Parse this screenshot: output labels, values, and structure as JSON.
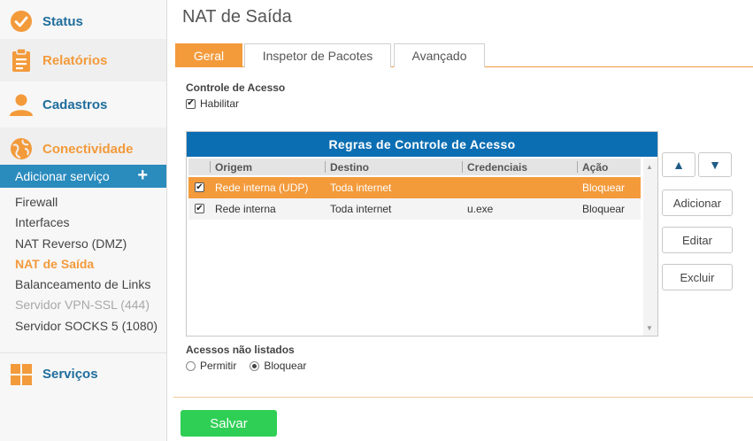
{
  "sidebar": {
    "status": "Status",
    "relatorios": "Relatórios",
    "cadastros": "Cadastros",
    "conectividade": "Conectividade",
    "add_service": "Adicionar serviço",
    "items": [
      "Firewall",
      "Interfaces",
      "NAT Reverso (DMZ)",
      "NAT de Saída",
      "Balanceamento de Links",
      "Servidor VPN-SSL (444)",
      "Servidor SOCKS 5 (1080)"
    ],
    "servicos": "Serviços"
  },
  "page": {
    "title": "NAT de Saída",
    "tabs": [
      "Geral",
      "Inspetor de Pacotes",
      "Avançado"
    ],
    "controle_title": "Controle de Acesso",
    "habilitar": "Habilitar",
    "rules_title": "Regras de Controle de Acesso",
    "columns": [
      "Origem",
      "Destino",
      "Credenciais",
      "Ação"
    ],
    "rows": [
      {
        "origem": "Rede interna (UDP)",
        "destino": "Toda internet",
        "credenciais": "",
        "acao": "Bloquear"
      },
      {
        "origem": "Rede interna",
        "destino": "Toda internet",
        "credenciais": "u.exe",
        "acao": "Bloquear"
      }
    ],
    "btn_up": "▲",
    "btn_down": "▼",
    "btn_add": "Adicionar",
    "btn_edit": "Editar",
    "btn_delete": "Excluir",
    "acessos_title": "Acessos não listados",
    "radio_permitir": "Permitir",
    "radio_bloquear": "Bloquear",
    "save": "Salvar"
  },
  "colors": {
    "accent_orange": "#f39a3b",
    "brand_blue": "#0b6eb3",
    "save_green": "#2fcf55"
  }
}
